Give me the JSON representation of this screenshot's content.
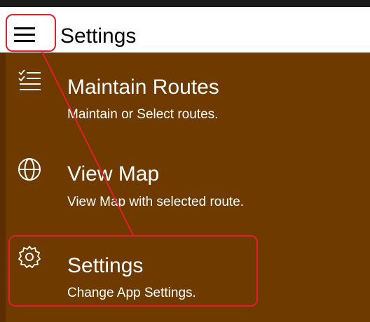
{
  "header": {
    "title": "Settings",
    "menu_icon": "hamburger-menu-icon"
  },
  "colors": {
    "menu_background": "#6e3a00",
    "annotation": "#e01e2e",
    "header_background": "#ffffff"
  },
  "menu": {
    "items": [
      {
        "title": "Maintain Routes",
        "subtitle": "Maintain or Select routes.",
        "icon": "checklist-icon"
      },
      {
        "title": "View Map",
        "subtitle": "View Map with selected route.",
        "icon": "globe-icon"
      },
      {
        "title": "Settings",
        "subtitle": "Change App Settings.",
        "icon": "gear-icon"
      }
    ]
  }
}
